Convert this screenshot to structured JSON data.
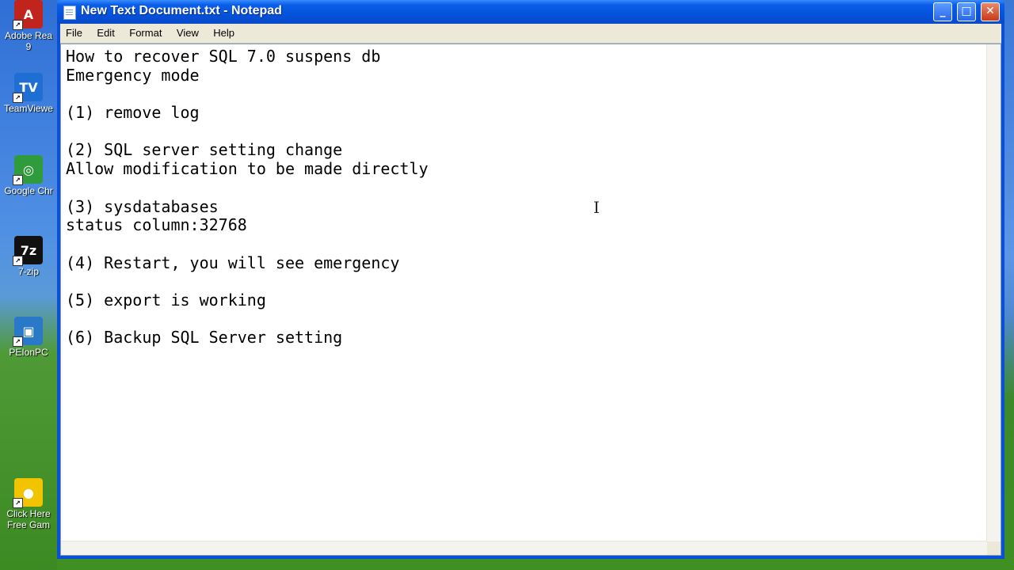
{
  "desktop": {
    "icons": [
      {
        "name": "adobe-reader-icon",
        "label": "Adobe Rea",
        "sub": "9",
        "color": "#c0241c",
        "glyph": "A"
      },
      {
        "name": "teamviewer-icon",
        "label": "TeamViewe",
        "sub": "",
        "color": "#1e6ed4",
        "glyph": "TV"
      },
      {
        "name": "google-chrome-icon",
        "label": "Google Chr",
        "sub": "",
        "color": "#2f9b3c",
        "glyph": "◎"
      },
      {
        "name": "seven-zip-icon",
        "label": "7-zip",
        "sub": "",
        "color": "#111111",
        "glyph": "7z"
      },
      {
        "name": "peionpc-icon",
        "label": "PEIonPC",
        "sub": "",
        "color": "#2a78c8",
        "glyph": "▣"
      },
      {
        "name": "free-games-icon",
        "label": "Click Here",
        "sub": "Free Gam",
        "color": "#f2c400",
        "glyph": "●"
      }
    ]
  },
  "window": {
    "title": "New Text Document.txt - Notepad",
    "buttons": {
      "minimize": "_",
      "maximize": "□",
      "close": "✕"
    }
  },
  "menu": [
    "File",
    "Edit",
    "Format",
    "View",
    "Help"
  ],
  "document": {
    "lines": [
      "How to recover SQL 7.0 suspens db",
      "Emergency mode",
      "",
      "(1) remove log",
      "",
      "(2) SQL server setting change",
      "Allow modification to be made directly",
      "",
      "(3) sysdatabases",
      "status column:32768",
      "",
      "(4) Restart, you will see emergency",
      "",
      "(5) export is working",
      "",
      "(6) Backup SQL Server setting"
    ]
  },
  "cursor": "I"
}
